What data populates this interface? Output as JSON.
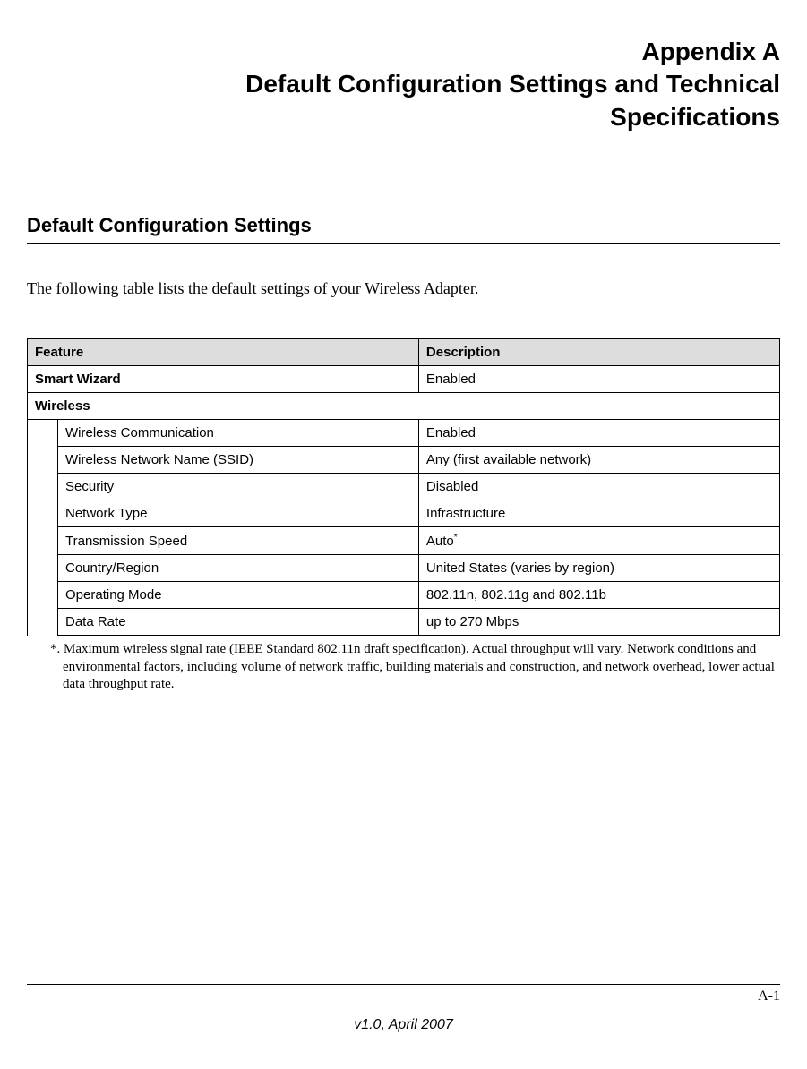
{
  "heading": {
    "line1": "Appendix A",
    "line2": "Default Configuration Settings and Technical",
    "line3": "Specifications"
  },
  "section_title": "Default Configuration Settings",
  "intro": "The following table lists the default settings of your Wireless Adapter.",
  "table": {
    "headers": {
      "col1": "Feature",
      "col2": "Description"
    },
    "row_smart_wizard": {
      "feature": "Smart Wizard",
      "value": "Enabled"
    },
    "row_wireless_header": "Wireless",
    "wireless_rows": [
      {
        "feature": "Wireless Communication",
        "value": "Enabled"
      },
      {
        "feature": "Wireless Network Name (SSID)",
        "value": "Any (first available network)"
      },
      {
        "feature": "Security",
        "value": "Disabled"
      },
      {
        "feature": "Network Type",
        "value": "Infrastructure"
      },
      {
        "feature": "Transmission Speed",
        "value": "Auto",
        "note_marker": "*"
      },
      {
        "feature": "Country/Region",
        "value": "United States (varies by region)"
      },
      {
        "feature": "Operating Mode",
        "value": "802.11n, 802.11g and 802.11b"
      },
      {
        "feature": "Data Rate",
        "value": "up to 270 Mbps"
      }
    ]
  },
  "footnote": "*. Maximum wireless signal rate (IEEE Standard 802.11n draft specification). Actual throughput will vary. Network conditions and environmental factors, including volume of network traffic, building materials and construction, and network overhead, lower actual data throughput rate.",
  "footer": {
    "page": "A-1",
    "version": "v1.0, April 2007"
  }
}
